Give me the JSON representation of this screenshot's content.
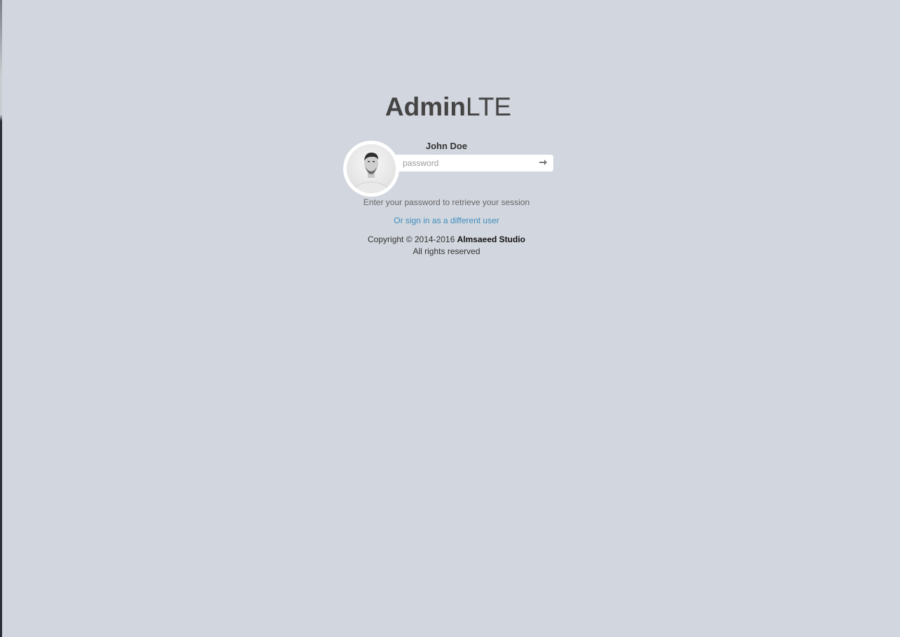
{
  "logo": {
    "bold": "Admin",
    "light": "LTE"
  },
  "user": {
    "name": "John Doe",
    "avatar_icon": "user-avatar-photo"
  },
  "password": {
    "placeholder": "password",
    "value": "",
    "submit_icon": "arrow-right-icon"
  },
  "help_text": "Enter your password to retrieve your session",
  "alt_link": "Or sign in as a different user",
  "footer": {
    "copyright_prefix": "Copyright © 2014-2016",
    "company": "Almsaeed Studio",
    "rights": "All rights reserved"
  },
  "colors": {
    "background": "#d2d6de",
    "link": "#3c8dbc",
    "text": "#444444"
  }
}
